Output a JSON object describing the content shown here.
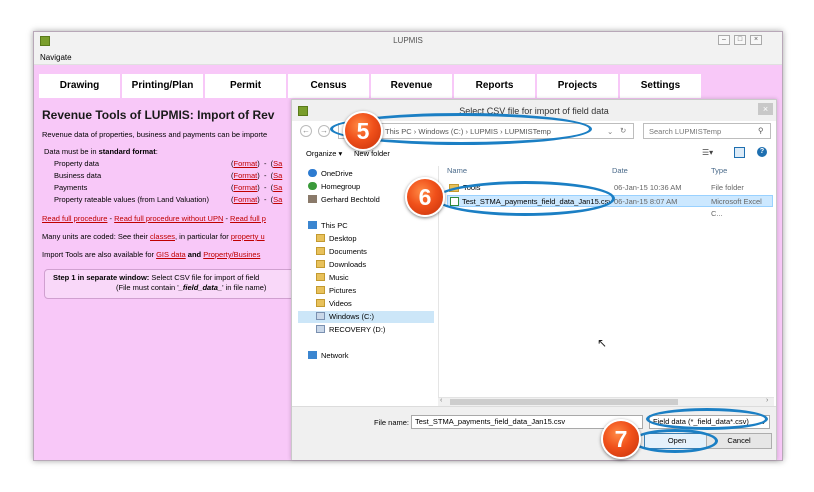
{
  "app": {
    "title": "LUPMIS",
    "menu_navigate": "Navigate",
    "tabs": [
      "Drawing",
      "Printing/Plan",
      "Permit",
      "Census",
      "Revenue",
      "Reports",
      "Projects",
      "Settings"
    ],
    "heading": "Revenue Tools of LUPMIS: Import of Rev",
    "intro": "Revenue data of properties, business and payments can be importe",
    "format_note_prefix": "Data must be in ",
    "format_note_bold": "standard format",
    "format_note_suffix": ":",
    "data_rows": [
      {
        "label": "Property data",
        "link": "Format",
        "sep": "-",
        "tail": "Sa"
      },
      {
        "label": "Business data",
        "link": "Format",
        "sep": "-",
        "tail": "Sa"
      },
      {
        "label": "Payments",
        "link": "Format",
        "sep": "-",
        "tail": "Sa"
      },
      {
        "label": "Property rateable values (from Land Valuation)",
        "link": "Format",
        "sep": "-",
        "tail": "Sa"
      }
    ],
    "procedure_links": [
      "Read full procedure",
      "Read full procedure without UPN",
      "Read full p"
    ],
    "units_line": {
      "prefix": "Many units are coded: See their ",
      "link1": "classes",
      "middle": ", in particular for ",
      "link2": "property u"
    },
    "import_line": {
      "prefix": "Import Tools are also available for ",
      "link1": "GIS data",
      "and": " and ",
      "link2": "Property/Busines"
    },
    "step": {
      "bold": "Step 1 in separate window:",
      "text": " Select CSV file for import of field",
      "line2_prefix": "(File must contain '",
      "line2_bold": "_field_data_",
      "line2_suffix": "' in file name)"
    }
  },
  "dialog": {
    "title": "Select CSV file for import of field data",
    "breadcrumb": [
      "This PC",
      "Windows (C:)",
      "LUPMIS",
      "LUPMISTemp"
    ],
    "search_placeholder": "Search LUPMISTemp",
    "organize": "Organize",
    "new_folder": "New folder",
    "nav": [
      {
        "label": "OneDrive",
        "icon": "cloud-icon"
      },
      {
        "label": "Homegroup",
        "icon": "homegroup-icon"
      },
      {
        "label": "Gerhard Bechtold",
        "icon": "user-icon"
      },
      {
        "label": "This PC",
        "icon": "computer-icon"
      },
      {
        "label": "Desktop",
        "icon": "folder-icon"
      },
      {
        "label": "Documents",
        "icon": "folder-icon"
      },
      {
        "label": "Downloads",
        "icon": "folder-icon"
      },
      {
        "label": "Music",
        "icon": "folder-icon"
      },
      {
        "label": "Pictures",
        "icon": "folder-icon"
      },
      {
        "label": "Videos",
        "icon": "folder-icon"
      },
      {
        "label": "Windows (C:)",
        "icon": "drive-icon"
      },
      {
        "label": "RECOVERY (D:)",
        "icon": "drive-icon"
      },
      {
        "label": "Network",
        "icon": "network-icon"
      }
    ],
    "columns": [
      "Name",
      "Date",
      "Type"
    ],
    "files": [
      {
        "name": "Tools",
        "date": "06-Jan-15 10:36 AM",
        "type": "File folder"
      },
      {
        "name": "Test_STMA_payments_field_data_Jan15.csv",
        "date": "06-Jan-15 8:07 AM",
        "type": "Microsoft Excel C..."
      }
    ],
    "file_name_label": "File name:",
    "file_name_value": "Test_STMA_payments_field_data_Jan15.csv",
    "filter": "Field data (*_field_data*.csv)",
    "open_label": "Open",
    "cancel_label": "Cancel"
  },
  "callouts": [
    "5",
    "6",
    "7"
  ],
  "colors": {
    "app_bg": "#f8c8f8",
    "callout": "#f0501a",
    "ring": "#1b7fc4",
    "link": "#c00000"
  }
}
